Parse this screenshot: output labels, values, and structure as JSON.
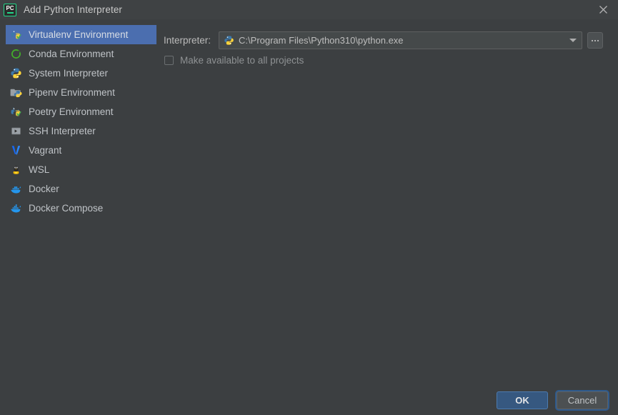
{
  "window": {
    "title": "Add Python Interpreter",
    "app_icon": "pycharm-icon",
    "close_icon": "close-icon"
  },
  "sidebar": {
    "items": [
      {
        "label": "Virtualenv Environment",
        "icon": "virtualenv-icon",
        "selected": true
      },
      {
        "label": "Conda Environment",
        "icon": "conda-icon",
        "selected": false
      },
      {
        "label": "System Interpreter",
        "icon": "python-icon",
        "selected": false
      },
      {
        "label": "Pipenv Environment",
        "icon": "pipenv-icon",
        "selected": false
      },
      {
        "label": "Poetry Environment",
        "icon": "poetry-icon",
        "selected": false
      },
      {
        "label": "SSH Interpreter",
        "icon": "ssh-icon",
        "selected": false
      },
      {
        "label": "Vagrant",
        "icon": "vagrant-icon",
        "selected": false
      },
      {
        "label": "WSL",
        "icon": "wsl-icon",
        "selected": false
      },
      {
        "label": "Docker",
        "icon": "docker-icon",
        "selected": false
      },
      {
        "label": "Docker Compose",
        "icon": "docker-compose-icon",
        "selected": false
      }
    ]
  },
  "main": {
    "interpreter_label": "Interpreter:",
    "interpreter_value": "C:\\Program Files\\Python310\\python.exe",
    "interpreter_icon": "python-icon",
    "dropdown_icon": "chevron-down-icon",
    "browse_label": "...",
    "checkbox": {
      "label": "Make available to all projects",
      "checked": false
    }
  },
  "footer": {
    "ok_label": "OK",
    "cancel_label": "Cancel"
  },
  "colors": {
    "background": "#3c3f41",
    "titlebar": "#3f4244",
    "selection": "#4b6eaf",
    "ok_button": "#365880",
    "focus_ring": "#2f5a8c",
    "accent_green": "#21d789",
    "python_blue": "#3c78aa",
    "python_yellow": "#ffd43b"
  }
}
